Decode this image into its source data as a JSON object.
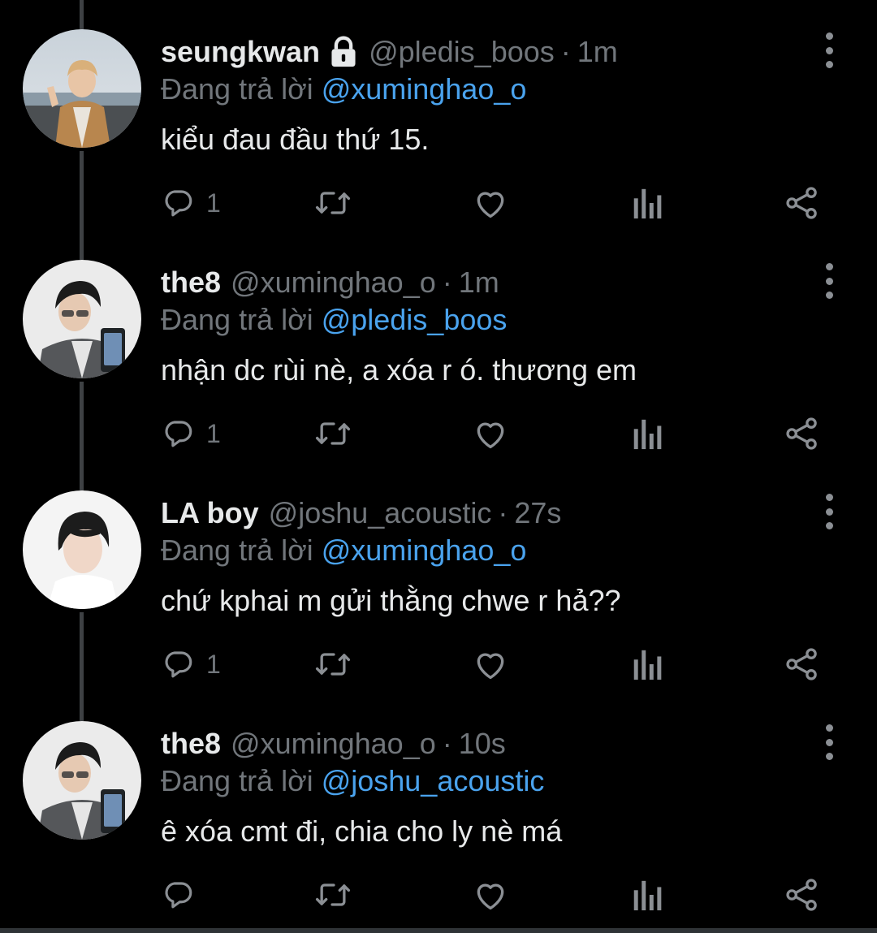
{
  "colors": {
    "background": "#000000",
    "text": "#e7e9ea",
    "muted": "#71767b",
    "link": "#4aa3ee",
    "thread_line": "#3e4144"
  },
  "tweets": [
    {
      "name": "seungkwan",
      "protected": true,
      "handle": "@pledis_boos",
      "dot": "·",
      "time": "1m",
      "reply_label": "Đang trả lời",
      "reply_to": "@xuminghao_o",
      "text": "kiểu đau đầu thứ 15.",
      "reply_count": "1",
      "avatar": "avatar-seungkwan"
    },
    {
      "name": "the8",
      "protected": false,
      "handle": "@xuminghao_o",
      "dot": "·",
      "time": "1m",
      "reply_label": "Đang trả lời",
      "reply_to": "@pledis_boos",
      "text": "nhận dc rùi nè, a xóa r ó. thương em",
      "reply_count": "1",
      "avatar": "avatar-the8"
    },
    {
      "name": "LA boy",
      "protected": false,
      "handle": "@joshu_acoustic",
      "dot": "·",
      "time": "27s",
      "reply_label": "Đang trả lời",
      "reply_to": "@xuminghao_o",
      "text": "chứ kphai m gửi thằng chwe r hả??",
      "reply_count": "1",
      "avatar": "avatar-la-boy"
    },
    {
      "name": "the8",
      "protected": false,
      "handle": "@xuminghao_o",
      "dot": "·",
      "time": "10s",
      "reply_label": "Đang trả lời",
      "reply_to": "@joshu_acoustic",
      "text": "ê xóa cmt đi, chia cho ly nè má",
      "reply_count": "",
      "avatar": "avatar-the8"
    }
  ],
  "icons": {
    "reply": "reply-icon",
    "retweet": "retweet-icon",
    "like": "heart-icon",
    "views": "views-icon",
    "share": "share-icon",
    "more": "more-options-icon",
    "lock": "lock-icon"
  }
}
